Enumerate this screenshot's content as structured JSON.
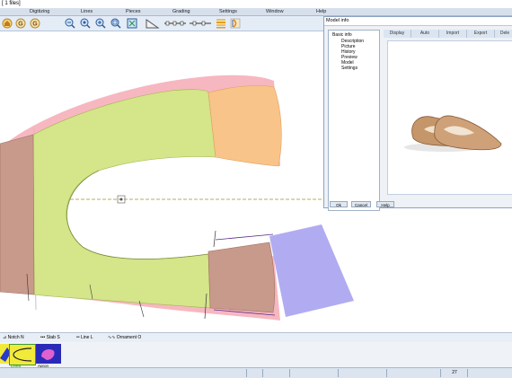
{
  "window": {
    "title": "[ 1 files]"
  },
  "menu": [
    "Digitizing",
    "Lines",
    "Pieces",
    "Grading",
    "Settings",
    "Window",
    "Help"
  ],
  "toolbar": {
    "icons": [
      "home-icon",
      "g-icon",
      "zoom-out-icon",
      "zoom-fit-icon",
      "zoom-in-icon",
      "zoom-window-icon",
      "zoom-extents-icon",
      "ruler-icon",
      "measure-line-icon",
      "measure-line-2-icon",
      "grading-table-icon",
      "notch-tool-icon"
    ]
  },
  "model_info": {
    "title": "Model info",
    "tree": {
      "root": "Basic info",
      "children": [
        "Description",
        "Picture",
        "History",
        "Preview",
        "Model",
        "Settings"
      ]
    },
    "tabs": [
      "Display",
      "Auto",
      "Import",
      "Export",
      "Dele"
    ],
    "buttons": {
      "ok": "Ok",
      "cancel": "Cancel",
      "help": "Help"
    }
  },
  "legend": [
    {
      "label": "Notch",
      "key": "N"
    },
    {
      "label": "Stab",
      "key": "S"
    },
    {
      "label": "Line",
      "key": "L"
    },
    {
      "label": "Ornament",
      "key": "O"
    }
  ],
  "pieces": [
    {
      "label": ""
    },
    {
      "label": "Linea"
    },
    {
      "label": "Apron"
    }
  ],
  "status": {
    "value": "27"
  },
  "colors": {
    "vamp_fill": "#d4e58a",
    "heel_fill": "#f9c48a",
    "back_fill": "#c89a8c",
    "lining_fill": "#a8a3f0",
    "allowance_pink": "#f6aab5",
    "accent_blue": "#2e4d8a"
  }
}
